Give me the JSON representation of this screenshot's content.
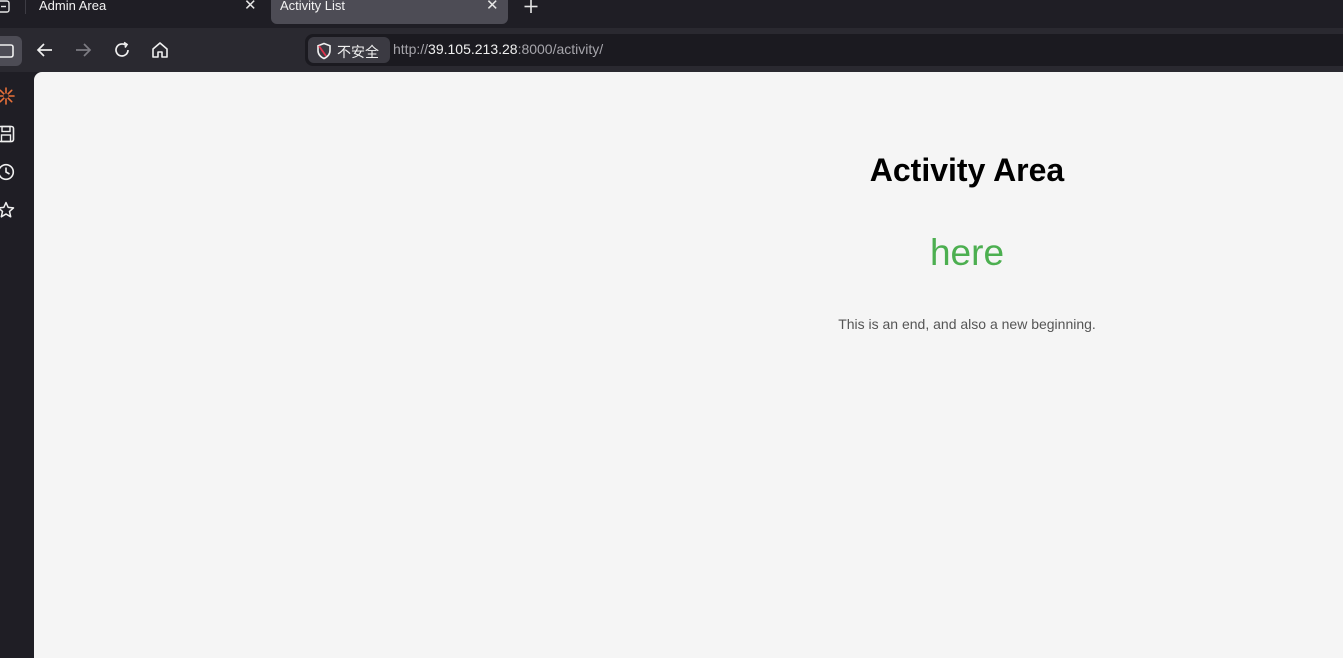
{
  "browser": {
    "tabs": [
      {
        "label": "Admin Area",
        "active": false
      },
      {
        "label": "Activity List",
        "active": true
      }
    ],
    "address": {
      "security_label": "不安全",
      "url_scheme": "http://",
      "url_host": "39.105.213.28",
      "url_rest": ":8000/activity/"
    },
    "icons": {
      "tab_panel": "tab-panel-icon",
      "close": "close-icon",
      "new_tab": "plus-icon",
      "sidebar_toggle": "sidebar-toggle-icon",
      "back": "arrow-left-icon",
      "forward": "arrow-right-icon",
      "reload": "reload-icon",
      "home": "home-icon",
      "security": "shield-icon",
      "sidebar_items": [
        "sparkle-icon",
        "save-icon",
        "history-icon",
        "star-icon"
      ]
    }
  },
  "page": {
    "title": "Activity Area",
    "link_text": "here",
    "tagline": "This is an end, and also a new beginning.",
    "colors": {
      "link": "#4caf50",
      "background": "#f5f5f5",
      "title": "#000000",
      "tagline": "#555555"
    }
  }
}
